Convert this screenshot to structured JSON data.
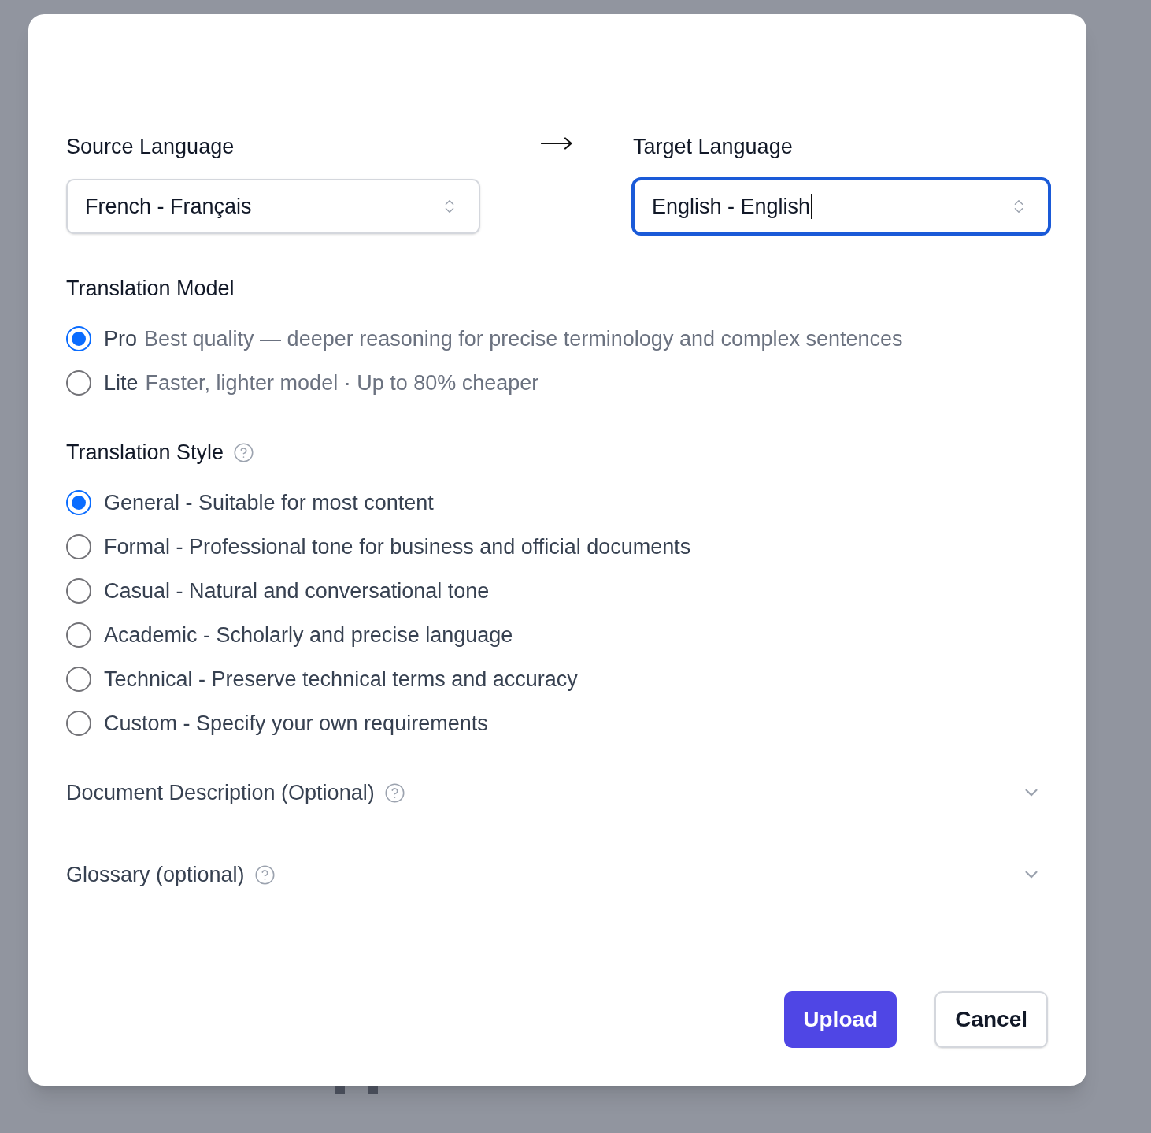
{
  "languages": {
    "source": {
      "label": "Source Language",
      "value": "French - Français",
      "focused": false
    },
    "target": {
      "label": "Target Language",
      "value": "English - English",
      "focused": true
    }
  },
  "model": {
    "label": "Translation Model",
    "options": [
      {
        "name": "Pro",
        "description": "Best quality — deeper reasoning for precise terminology and complex sentences",
        "selected": true
      },
      {
        "name": "Lite",
        "description": "Faster, lighter model · Up to 80% cheaper",
        "selected": false
      }
    ]
  },
  "style": {
    "label": "Translation Style",
    "options": [
      {
        "label": "General - Suitable for most content",
        "selected": true
      },
      {
        "label": "Formal - Professional tone for business and official documents",
        "selected": false
      },
      {
        "label": "Casual - Natural and conversational tone",
        "selected": false
      },
      {
        "label": "Academic - Scholarly and precise language",
        "selected": false
      },
      {
        "label": "Technical - Preserve technical terms and accuracy",
        "selected": false
      },
      {
        "label": "Custom - Specify your own requirements",
        "selected": false
      }
    ]
  },
  "sections": [
    {
      "label": "Document Description (Optional)",
      "expanded": false
    },
    {
      "label": "Glossary (optional)",
      "expanded": false
    }
  ],
  "buttons": [
    {
      "label": "Upload",
      "kind": "primary"
    },
    {
      "label": "Cancel",
      "kind": "secondary"
    }
  ]
}
